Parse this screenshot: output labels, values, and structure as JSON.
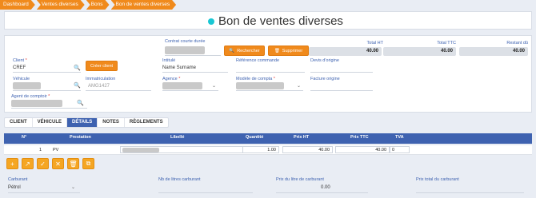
{
  "breadcrumb": [
    "Dashboard",
    "Ventes diverses",
    "Bons",
    "Bon de ventes diverses"
  ],
  "page": {
    "title": "Bon de ventes diverses"
  },
  "form": {
    "contrat_label": "Contrat courte durée",
    "rechercher": "Rechercher",
    "supprimer": "Supprimer",
    "total_ht_label": "Total HT",
    "total_ht": "40.00",
    "total_ttc_label": "Total TTC",
    "total_ttc": "40.00",
    "restant_label": "Restant dû",
    "restant": "40.00",
    "client_label": "Client",
    "client_value": "CREF",
    "creer_client": "Créer client",
    "intitule_label": "Intitulé",
    "intitule_value": "Name Surname",
    "ref_commande_label": "Référence commande",
    "devis_label": "Devis d'origine",
    "vehicule_label": "Véhicule",
    "immat_label": "Immatriculation",
    "immat_value": "AMG1427",
    "agence_label": "Agence",
    "modele_label": "Modèle de compta",
    "facture_label": "Facture origine",
    "agent_label": "Agent de comptoir"
  },
  "tabs": [
    "CLIENT",
    "VÉHICULE",
    "DÉTAILS",
    "NOTES",
    "RÈGLEMENTS"
  ],
  "active_tab": "DÉTAILS",
  "table": {
    "headers": [
      "N°",
      "Prestation",
      "Libellé",
      "Quantité",
      "Prix HT",
      "Prix TTC",
      "TVA"
    ],
    "rows": [
      {
        "n": "1",
        "prestation": "PV",
        "quantite": "1.00",
        "prix_ht": "40.00",
        "prix_ttc": "40.00",
        "tva": "0"
      }
    ]
  },
  "bottom": {
    "carburant_label": "Carburant",
    "carburant_value": "Pétrol",
    "nb_litres_label": "Nb de litres carburant",
    "prix_litre_label": "Prix du litre de carburant",
    "prix_litre_value": "0.00",
    "prix_total_label": "Prix total du carburant"
  },
  "colors": {
    "accent": "#f08a1c",
    "primary": "#3e62b0",
    "title_dot": "#19c7d4"
  }
}
